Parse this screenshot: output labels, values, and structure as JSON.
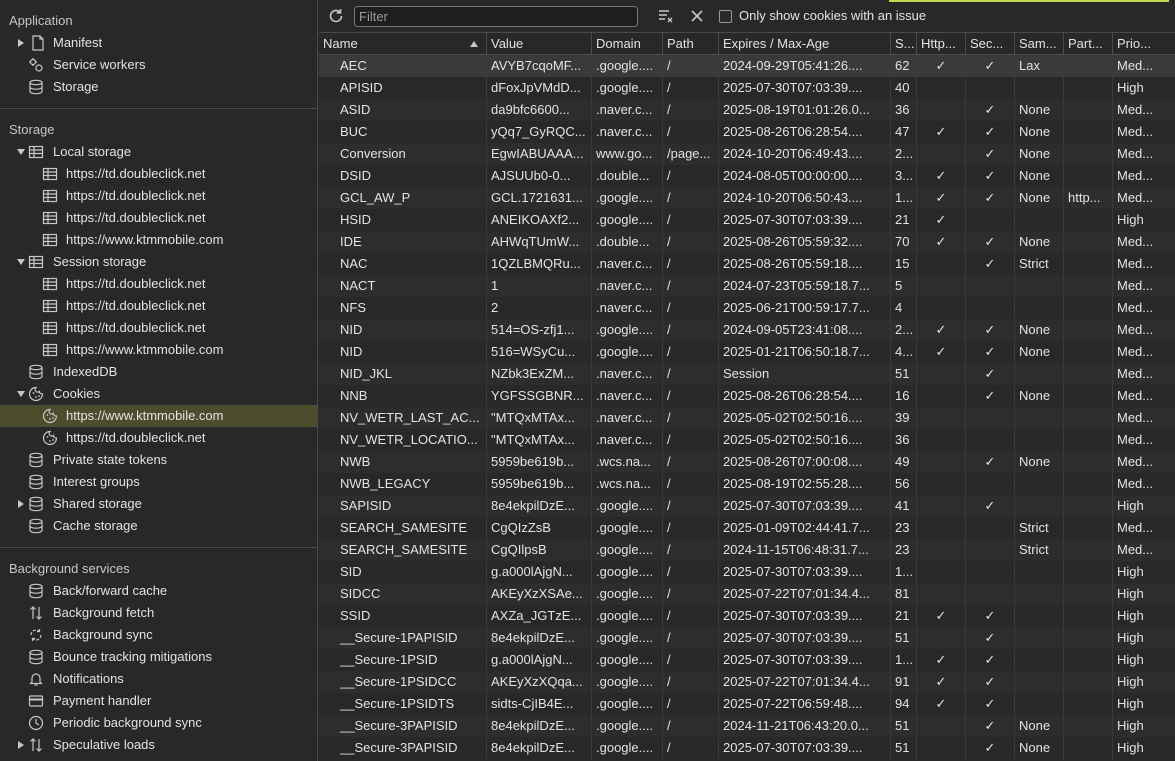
{
  "sidebar": {
    "application": {
      "title": "Application",
      "items": [
        {
          "label": "Manifest",
          "icon": "document-icon"
        },
        {
          "label": "Service workers",
          "icon": "gears-icon"
        },
        {
          "label": "Storage",
          "icon": "database-icon"
        }
      ]
    },
    "storage": {
      "title": "Storage",
      "local_storage": {
        "label": "Local storage",
        "children": [
          "https://td.doubleclick.net",
          "https://td.doubleclick.net",
          "https://td.doubleclick.net",
          "https://www.ktmmobile.com"
        ]
      },
      "session_storage": {
        "label": "Session storage",
        "children": [
          "https://td.doubleclick.net",
          "https://td.doubleclick.net",
          "https://td.doubleclick.net",
          "https://www.ktmmobile.com"
        ]
      },
      "indexeddb": "IndexedDB",
      "cookies": {
        "label": "Cookies",
        "children": [
          "https://www.ktmmobile.com",
          "https://td.doubleclick.net"
        ]
      },
      "private_state_tokens": "Private state tokens",
      "interest_groups": "Interest groups",
      "shared_storage": "Shared storage",
      "cache_storage": "Cache storage"
    },
    "background": {
      "title": "Background services",
      "items": [
        {
          "label": "Back/forward cache",
          "icon": "database-icon"
        },
        {
          "label": "Background fetch",
          "icon": "up-down-arrows-icon"
        },
        {
          "label": "Background sync",
          "icon": "sync-icon"
        },
        {
          "label": "Bounce tracking mitigations",
          "icon": "database-icon"
        },
        {
          "label": "Notifications",
          "icon": "bell-icon"
        },
        {
          "label": "Payment handler",
          "icon": "card-icon"
        },
        {
          "label": "Periodic background sync",
          "icon": "clock-icon"
        },
        {
          "label": "Speculative loads",
          "icon": "up-down-arrows-icon"
        }
      ]
    }
  },
  "toolbar": {
    "filter_placeholder": "Filter",
    "only_issue_label": "Only show cookies with an issue"
  },
  "table": {
    "headers": [
      "Name",
      "Value",
      "Domain",
      "Path",
      "Expires / Max-Age",
      "S...",
      "Http...",
      "Sec...",
      "Sam...",
      "Part...",
      "Prio..."
    ],
    "rows": [
      [
        "AEC",
        "AVYB7cqoMF...",
        ".google....",
        "/",
        "2024-09-29T05:41:26....",
        "62",
        "✓",
        "✓",
        "Lax",
        "",
        "Med..."
      ],
      [
        "APISID",
        "dFoxJpVMdD...",
        ".google....",
        "/",
        "2025-07-30T07:03:39....",
        "40",
        "",
        "",
        "",
        "",
        "High"
      ],
      [
        "ASID",
        "da9bfc6600...",
        ".naver.c...",
        "/",
        "2025-08-19T01:01:26.0...",
        "36",
        "",
        "✓",
        "None",
        "",
        "Med..."
      ],
      [
        "BUC",
        "yQq7_GyRQC...",
        ".naver.c...",
        "/",
        "2025-08-26T06:28:54....",
        "47",
        "✓",
        "✓",
        "None",
        "",
        "Med..."
      ],
      [
        "Conversion",
        "EgwIABUAAA...",
        "www.go...",
        "/page...",
        "2024-10-20T06:49:43....",
        "2...",
        "",
        "✓",
        "None",
        "",
        "Med..."
      ],
      [
        "DSID",
        "AJSUUb0-0...",
        ".double...",
        "/",
        "2024-08-05T00:00:00....",
        "3...",
        "✓",
        "✓",
        "None",
        "",
        "Med..."
      ],
      [
        "GCL_AW_P",
        "GCL.1721631...",
        ".google....",
        "/",
        "2024-10-20T06:50:43....",
        "1...",
        "✓",
        "✓",
        "None",
        "http...",
        "Med..."
      ],
      [
        "HSID",
        "ANEIKOAXf2...",
        ".google....",
        "/",
        "2025-07-30T07:03:39....",
        "21",
        "✓",
        "",
        "",
        "",
        "High"
      ],
      [
        "IDE",
        "AHWqTUmW...",
        ".double...",
        "/",
        "2025-08-26T05:59:32....",
        "70",
        "✓",
        "✓",
        "None",
        "",
        "Med..."
      ],
      [
        "NAC",
        "1QZLBMQRu...",
        ".naver.c...",
        "/",
        "2025-08-26T05:59:18....",
        "15",
        "",
        "✓",
        "Strict",
        "",
        "Med..."
      ],
      [
        "NACT",
        "1",
        ".naver.c...",
        "/",
        "2024-07-23T05:59:18.7...",
        "5",
        "",
        "",
        "",
        "",
        "Med..."
      ],
      [
        "NFS",
        "2",
        ".naver.c...",
        "/",
        "2025-06-21T00:59:17.7...",
        "4",
        "",
        "",
        "",
        "",
        "Med..."
      ],
      [
        "NID",
        "514=OS-zfj1...",
        ".google....",
        "/",
        "2024-09-05T23:41:08....",
        "2...",
        "✓",
        "✓",
        "None",
        "",
        "Med..."
      ],
      [
        "NID",
        "516=WSyCu...",
        ".google....",
        "/",
        "2025-01-21T06:50:18.7...",
        "4...",
        "✓",
        "✓",
        "None",
        "",
        "Med..."
      ],
      [
        "NID_JKL",
        "NZbk3ExZM...",
        ".naver.c...",
        "/",
        "Session",
        "51",
        "",
        "✓",
        "",
        "",
        "Med..."
      ],
      [
        "NNB",
        "YGFSSGBNR...",
        ".naver.c...",
        "/",
        "2025-08-26T06:28:54....",
        "16",
        "",
        "✓",
        "None",
        "",
        "Med..."
      ],
      [
        "NV_WETR_LAST_AC...",
        "\"MTQxMTAx...",
        ".naver.c...",
        "/",
        "2025-05-02T02:50:16....",
        "39",
        "",
        "",
        "",
        "",
        "Med..."
      ],
      [
        "NV_WETR_LOCATIO...",
        "\"MTQxMTAx...",
        ".naver.c...",
        "/",
        "2025-05-02T02:50:16....",
        "36",
        "",
        "",
        "",
        "",
        "Med..."
      ],
      [
        "NWB",
        "5959be619b...",
        ".wcs.na...",
        "/",
        "2025-08-26T07:00:08....",
        "49",
        "",
        "✓",
        "None",
        "",
        "Med..."
      ],
      [
        "NWB_LEGACY",
        "5959be619b...",
        ".wcs.na...",
        "/",
        "2025-08-19T02:55:28....",
        "56",
        "",
        "",
        "",
        "",
        "Med..."
      ],
      [
        "SAPISID",
        "8e4ekpilDzE...",
        ".google....",
        "/",
        "2025-07-30T07:03:39....",
        "41",
        "",
        "✓",
        "",
        "",
        "High"
      ],
      [
        "SEARCH_SAMESITE",
        "CgQIzZsB",
        ".google....",
        "/",
        "2025-01-09T02:44:41.7...",
        "23",
        "",
        "",
        "Strict",
        "",
        "Med..."
      ],
      [
        "SEARCH_SAMESITE",
        "CgQIlpsB",
        ".google....",
        "/",
        "2024-11-15T06:48:31.7...",
        "23",
        "",
        "",
        "Strict",
        "",
        "Med..."
      ],
      [
        "SID",
        "g.a000lAjgN...",
        ".google....",
        "/",
        "2025-07-30T07:03:39....",
        "1...",
        "",
        "",
        "",
        "",
        "High"
      ],
      [
        "SIDCC",
        "AKEyXzXSAe...",
        ".google....",
        "/",
        "2025-07-22T07:01:34.4...",
        "81",
        "",
        "",
        "",
        "",
        "High"
      ],
      [
        "SSID",
        "AXZa_JGTzE...",
        ".google....",
        "/",
        "2025-07-30T07:03:39....",
        "21",
        "✓",
        "✓",
        "",
        "",
        "High"
      ],
      [
        "__Secure-1PAPISID",
        "8e4ekpilDzE...",
        ".google....",
        "/",
        "2025-07-30T07:03:39....",
        "51",
        "",
        "✓",
        "",
        "",
        "High"
      ],
      [
        "__Secure-1PSID",
        "g.a000lAjgN...",
        ".google....",
        "/",
        "2025-07-30T07:03:39....",
        "1...",
        "✓",
        "✓",
        "",
        "",
        "High"
      ],
      [
        "__Secure-1PSIDCC",
        "AKEyXzXQqa...",
        ".google....",
        "/",
        "2025-07-22T07:01:34.4...",
        "91",
        "✓",
        "✓",
        "",
        "",
        "High"
      ],
      [
        "__Secure-1PSIDTS",
        "sidts-CjIB4E...",
        ".google....",
        "/",
        "2025-07-22T06:59:48....",
        "94",
        "✓",
        "✓",
        "",
        "",
        "High"
      ],
      [
        "__Secure-3PAPISID",
        "8e4ekpilDzE...",
        ".google....",
        "/",
        "2024-11-21T06:43:20.0...",
        "51",
        "",
        "✓",
        "None",
        "",
        "High"
      ],
      [
        "__Secure-3PAPISID",
        "8e4ekpilDzE...",
        ".google....",
        "/",
        "2025-07-30T07:03:39....",
        "51",
        "",
        "✓",
        "None",
        "",
        "High"
      ]
    ]
  },
  "colors": {
    "accent": "#c4d54a",
    "selected": "#4d4d2e",
    "background": "#282828"
  }
}
